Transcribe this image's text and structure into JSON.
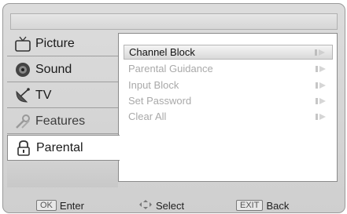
{
  "menu": {
    "items": [
      {
        "label": "Picture",
        "icon": "tv-icon"
      },
      {
        "label": "Sound",
        "icon": "speaker-icon"
      },
      {
        "label": "TV",
        "icon": "satellite-dish-icon"
      },
      {
        "label": "Features",
        "icon": "tools-icon"
      },
      {
        "label": "Parental",
        "icon": "lock-icon"
      }
    ],
    "active_index": 4
  },
  "options": [
    {
      "label": "Channel Block"
    },
    {
      "label": "Parental Guidance"
    },
    {
      "label": "Input Block"
    },
    {
      "label": "Set Password"
    },
    {
      "label": "Clear All"
    }
  ],
  "selected_option": 0,
  "footer": {
    "ok_key": "OK",
    "ok_label": "Enter",
    "select_label": "Select",
    "exit_key": "EXIT",
    "exit_label": "Back"
  },
  "colors": {
    "background": "#d4d4d4",
    "highlight": "#ffffff",
    "dim_text": "#a9a9a9"
  }
}
